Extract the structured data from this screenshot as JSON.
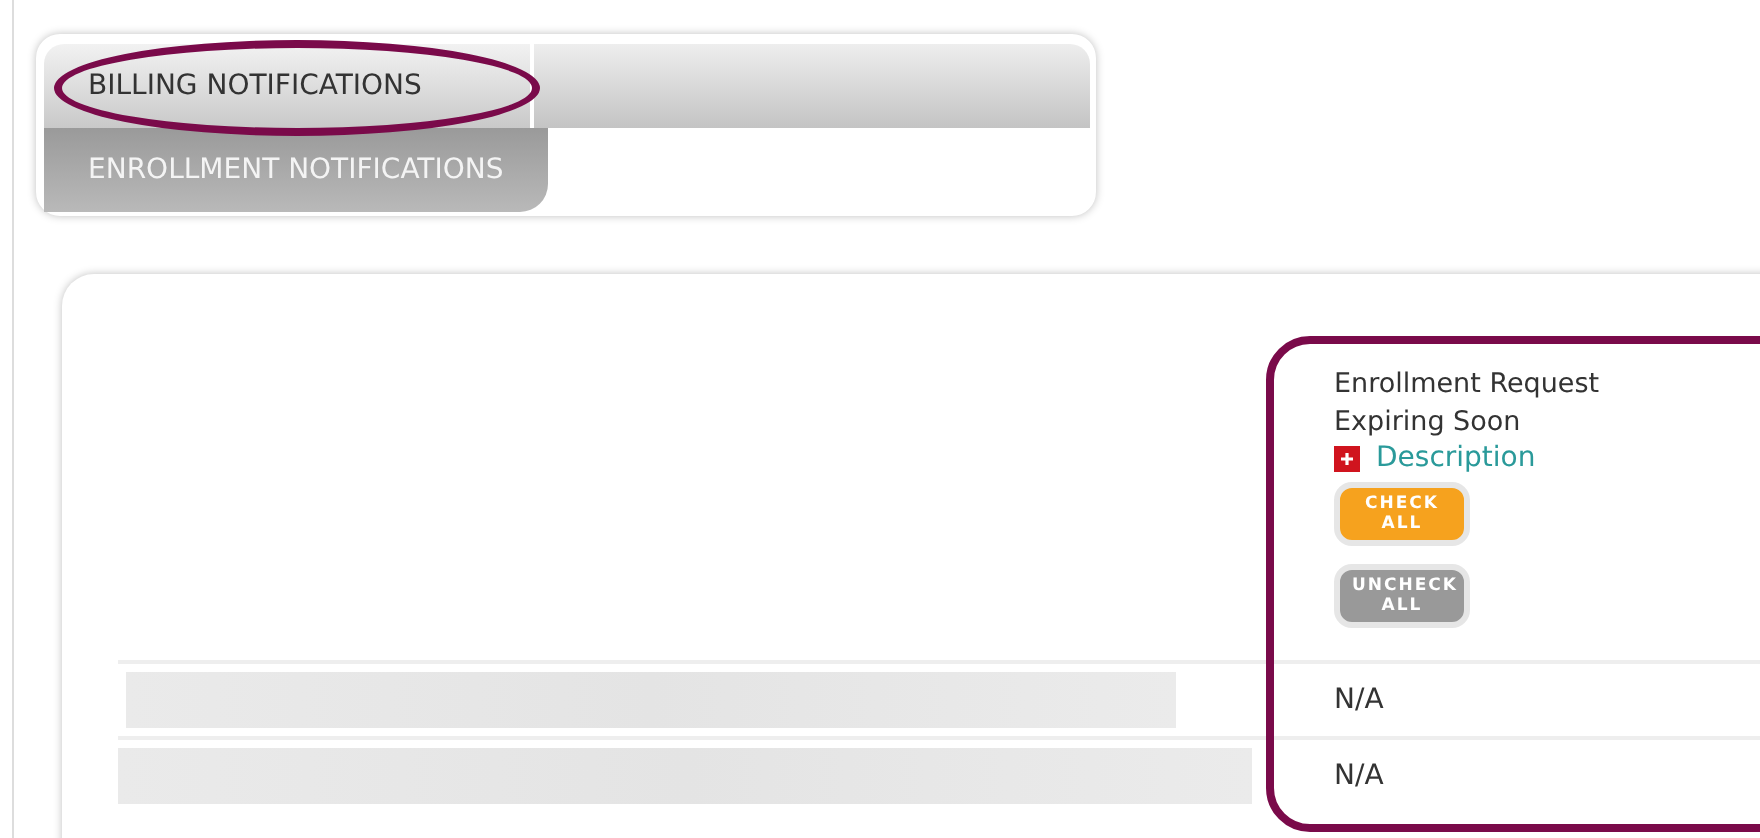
{
  "tabs": [
    {
      "label": "BILLING NOTIFICATIONS",
      "selected": true
    },
    {
      "label": "ENROLLMENT NOTIFICATIONS",
      "selected": false
    }
  ],
  "table": {
    "column_header": {
      "title": "Enrollment Request Expiring Soon",
      "link": "Description"
    },
    "buttons": [
      {
        "label": "CHECK ALL",
        "kind": "check"
      },
      {
        "label": "UNCHECK ALL",
        "kind": "uncheck"
      }
    ],
    "rows": [
      {
        "value": "N/A"
      },
      {
        "value": "N/A"
      }
    ]
  }
}
